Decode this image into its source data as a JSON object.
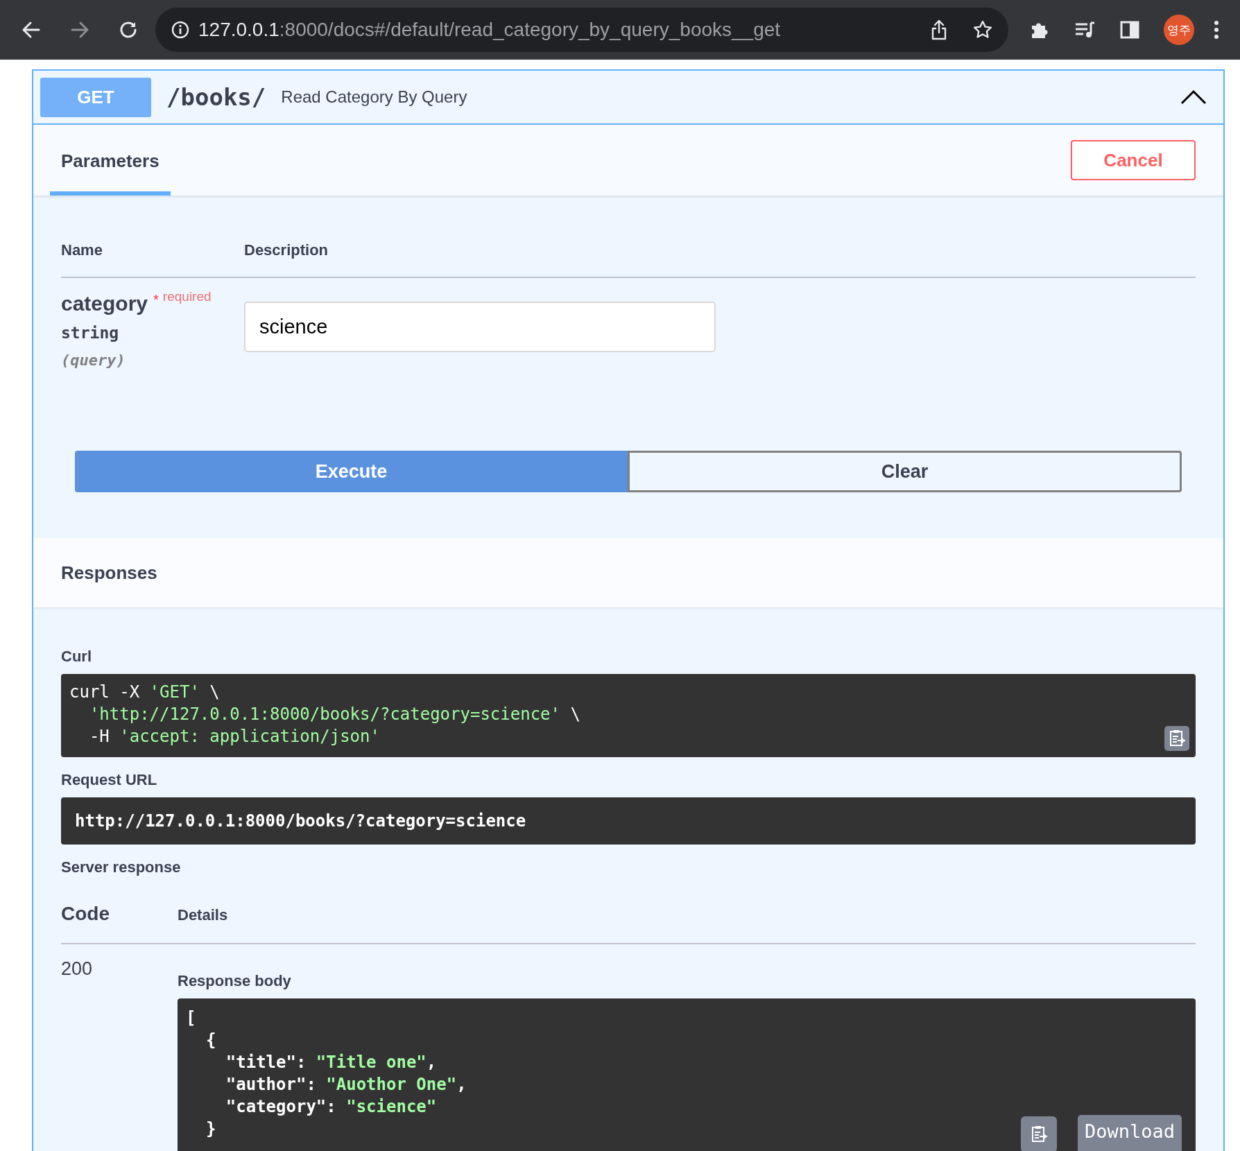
{
  "browser": {
    "url_host": "127.0.0.1",
    "url_path": ":8000/docs#/default/read_category_by_query_books__get",
    "profile": "영주"
  },
  "operation": {
    "method": "GET",
    "path": "/books/",
    "summary": "Read Category By Query",
    "expanded": true
  },
  "tabs": [
    {
      "label": "Parameters",
      "selected": true
    }
  ],
  "cancel_button": "Cancel",
  "parameters": {
    "columns": [
      "Name",
      "Description"
    ],
    "rows": [
      {
        "name": "category",
        "required_mark": "*",
        "required": "required",
        "type": "string",
        "location": "(query)",
        "value": "science"
      }
    ]
  },
  "buttons": [
    "Execute",
    "Clear"
  ],
  "responses": {
    "title": "Responses",
    "curl_label": "Curl",
    "curl": [
      [
        {
          "kind": "plain",
          "text": "curl -X "
        },
        {
          "kind": "string",
          "text": "'GET'"
        },
        {
          "kind": "plain",
          "text": " \\"
        }
      ],
      [
        {
          "kind": "string",
          "text": "  'http://127.0.0.1:8000/books/?category=science'"
        },
        {
          "kind": "plain",
          "text": " \\"
        }
      ],
      [
        {
          "kind": "plain",
          "text": "  -H "
        },
        {
          "kind": "string",
          "text": "'accept: application/json'"
        }
      ]
    ],
    "request_url_label": "Request URL",
    "request_url": "http://127.0.0.1:8000/books/?category=science",
    "server_response_label": "Server response",
    "columns": [
      "Code",
      "Details"
    ],
    "rows": [
      {
        "code": "200",
        "body_label": "Response body",
        "body": [
          [
            {
              "kind": "plain",
              "text": "["
            }
          ],
          [
            {
              "kind": "plain",
              "text": "  {"
            }
          ],
          [
            {
              "kind": "plain",
              "text": "    \"title\": "
            },
            {
              "kind": "string",
              "text": "\"Title one\""
            },
            {
              "kind": "plain",
              "text": ","
            }
          ],
          [
            {
              "kind": "plain",
              "text": "    \"author\": "
            },
            {
              "kind": "string",
              "text": "\"Auothor One\""
            },
            {
              "kind": "plain",
              "text": ","
            }
          ],
          [
            {
              "kind": "plain",
              "text": "    \"category\": "
            },
            {
              "kind": "string",
              "text": "\"science\""
            }
          ],
          [
            {
              "kind": "plain",
              "text": "  }"
            }
          ]
        ],
        "download_button": "Download"
      }
    ]
  }
}
